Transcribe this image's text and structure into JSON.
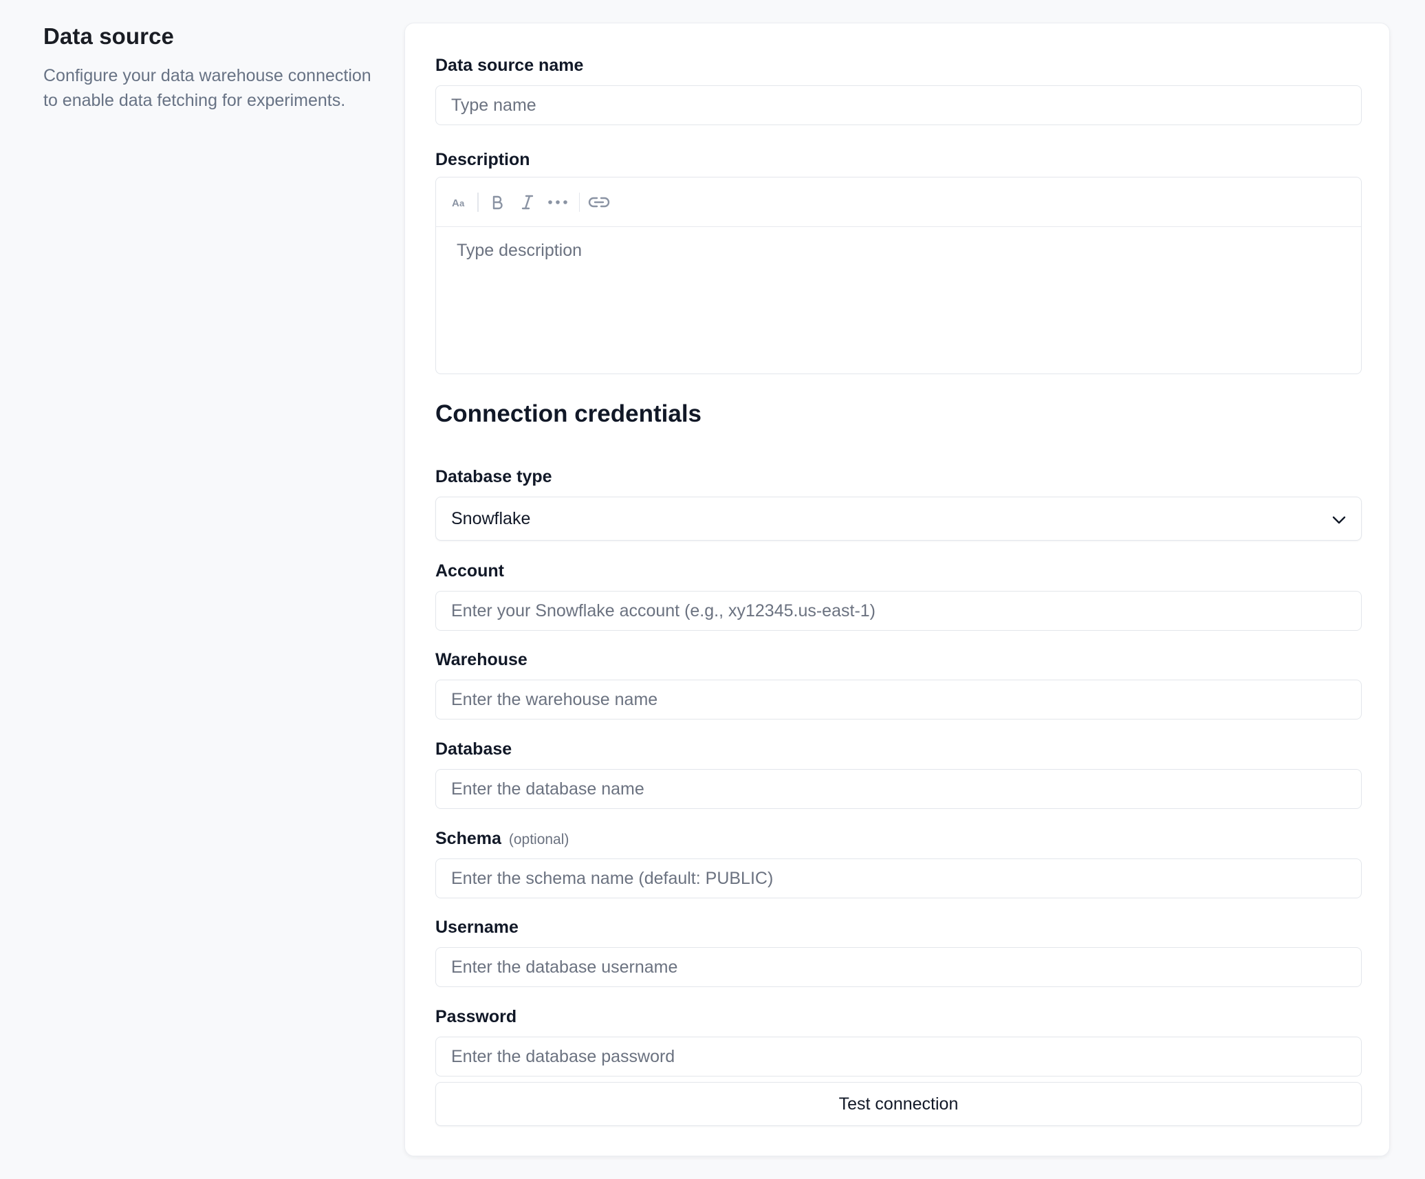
{
  "intro": {
    "title": "Data source",
    "description": "Configure your data warehouse connection to enable data fetching for experiments."
  },
  "form": {
    "name": {
      "label": "Data source name",
      "placeholder": "Type name",
      "value": ""
    },
    "description": {
      "label": "Description",
      "placeholder": "Type description",
      "toolbar": {
        "text_style_icon": "text-size-icon",
        "bold_icon": "bold-icon",
        "italic_icon": "italic-icon",
        "more_icon": "more-horizontal-icon",
        "link_icon": "link-icon"
      }
    },
    "credentials_title": "Connection credentials",
    "database_type": {
      "label": "Database type",
      "value": "Snowflake"
    },
    "account": {
      "label": "Account",
      "placeholder": "Enter your Snowflake account (e.g., xy12345.us-east-1)"
    },
    "warehouse": {
      "label": "Warehouse",
      "placeholder": "Enter the warehouse name"
    },
    "database": {
      "label": "Database",
      "placeholder": "Enter the database name"
    },
    "schema": {
      "label": "Schema",
      "optional": "(optional)",
      "placeholder": "Enter the schema name (default: PUBLIC)"
    },
    "username": {
      "label": "Username",
      "placeholder": "Enter the database username"
    },
    "password": {
      "label": "Password",
      "placeholder": "Enter the database password"
    },
    "test_button": "Test connection"
  },
  "colors": {
    "background": "#f8f9fb",
    "card": "#ffffff",
    "border": "#e3e6eb",
    "text": "#111827",
    "muted": "#6b7280"
  }
}
